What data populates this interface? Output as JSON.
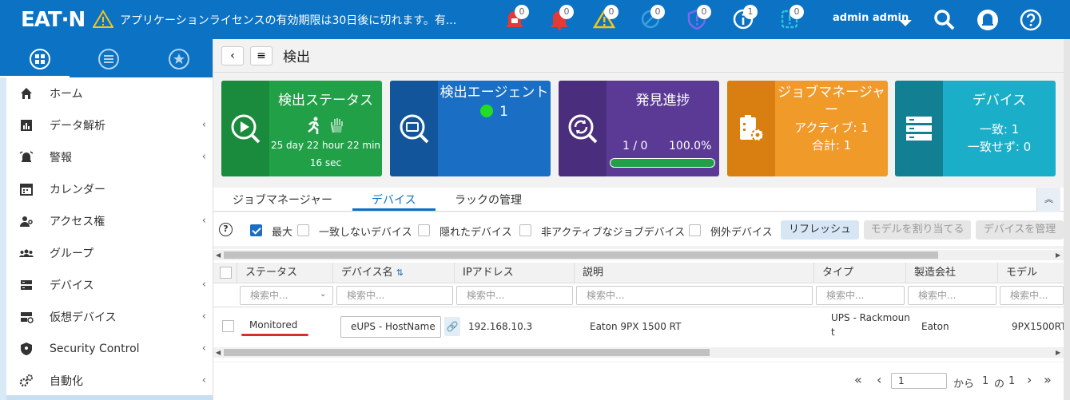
{
  "header": {
    "logo": "EAT·N",
    "license_message": "アプリケーションライセンスの有効期限は30日後に切れます。有...",
    "notifications": [
      {
        "icon": "alarm-bell-icon",
        "count": "0",
        "color": "#e53935"
      },
      {
        "icon": "bell-icon",
        "count": "0",
        "color": "#e53935"
      },
      {
        "icon": "warning-icon",
        "count": "0",
        "color": "#f5c518"
      },
      {
        "icon": "disabled-icon",
        "count": "0",
        "color": "#3aa0e0"
      },
      {
        "icon": "shield-alert-icon",
        "count": "0",
        "color": "#7b68ee"
      },
      {
        "icon": "info-icon",
        "count": "1",
        "color": "#ffffff"
      },
      {
        "icon": "device-alert-icon",
        "count": "0",
        "color": "#2ec4d6"
      }
    ],
    "user": "admin admin"
  },
  "sidebar": {
    "items": [
      {
        "label": "ホーム",
        "icon": "home-icon",
        "chevron": ""
      },
      {
        "label": "データ解析",
        "icon": "chart-icon",
        "chevron": "‹"
      },
      {
        "label": "警報",
        "icon": "alarm-icon",
        "chevron": "‹"
      },
      {
        "label": "カレンダー",
        "icon": "calendar-icon",
        "chevron": ""
      },
      {
        "label": "アクセス権",
        "icon": "access-icon",
        "chevron": "‹"
      },
      {
        "label": "グループ",
        "icon": "group-icon",
        "chevron": ""
      },
      {
        "label": "デバイス",
        "icon": "device-icon",
        "chevron": "‹"
      },
      {
        "label": "仮想デバイス",
        "icon": "virtual-device-icon",
        "chevron": "‹"
      },
      {
        "label": "Security Control",
        "icon": "security-shield-icon",
        "chevron": "‹"
      },
      {
        "label": "自動化",
        "icon": "gears-icon",
        "chevron": "‹"
      }
    ]
  },
  "page": {
    "back": "‹",
    "menu": "≡",
    "title": "検出"
  },
  "cards": [
    {
      "title": "検出ステータス",
      "lines": [
        "25 day 22 hour 22 min",
        "16 sec"
      ],
      "color": "#21a047",
      "dark": "#1a8a3c"
    },
    {
      "title": "検出エージェント",
      "lines": [
        "1"
      ],
      "color": "#1a6fc4",
      "dark": "#12559a"
    },
    {
      "title": "発見進捗",
      "lines": [
        "1 / 0",
        "100.0%"
      ],
      "progress": 100,
      "color": "#5b3a96",
      "dark": "#4a2e7d"
    },
    {
      "title": "ジョブマネージャー",
      "lines": [
        "アクティブ: 1",
        "合計: 1"
      ],
      "color": "#f09a2a",
      "dark": "#d97f12"
    },
    {
      "title": "デバイス",
      "lines": [
        "一致: 1",
        "一致せず: 0"
      ],
      "color": "#1aaec8",
      "dark": "#137f93"
    }
  ],
  "tabs": [
    "ジョブマネージャー",
    "デバイス",
    "ラックの管理"
  ],
  "filters": {
    "max_label": "最大",
    "mismatch_label": "一致しないデバイス",
    "hidden_label": "隠れたデバイス",
    "inactive_label": "非アクティブなジョブデバイス",
    "exception_label": "例外デバイス",
    "refresh": "リフレッシュ",
    "assign_model": "モデルを割り当てる",
    "manage_device": "デバイスを管理"
  },
  "grid": {
    "columns": [
      "ステータス",
      "デバイス名",
      "IPアドレス",
      "説明",
      "タイプ",
      "製造会社",
      "モデル"
    ],
    "search_placeholder": "検索中...",
    "rows": [
      {
        "status": "Monitored",
        "device_name": "eUPS - HostName",
        "ip": "192.168.10.3",
        "description": "Eaton 9PX 1500 RT",
        "type_line1": "UPS - Rackmoun",
        "type_line2": "t",
        "manufacturer": "Eaton",
        "model": "9PX1500RT"
      }
    ]
  },
  "pager": {
    "first": "«",
    "prev": "‹",
    "page": "1",
    "from": "から",
    "current": "1",
    "of": "の",
    "total": "1",
    "next": "›",
    "last": "»"
  }
}
